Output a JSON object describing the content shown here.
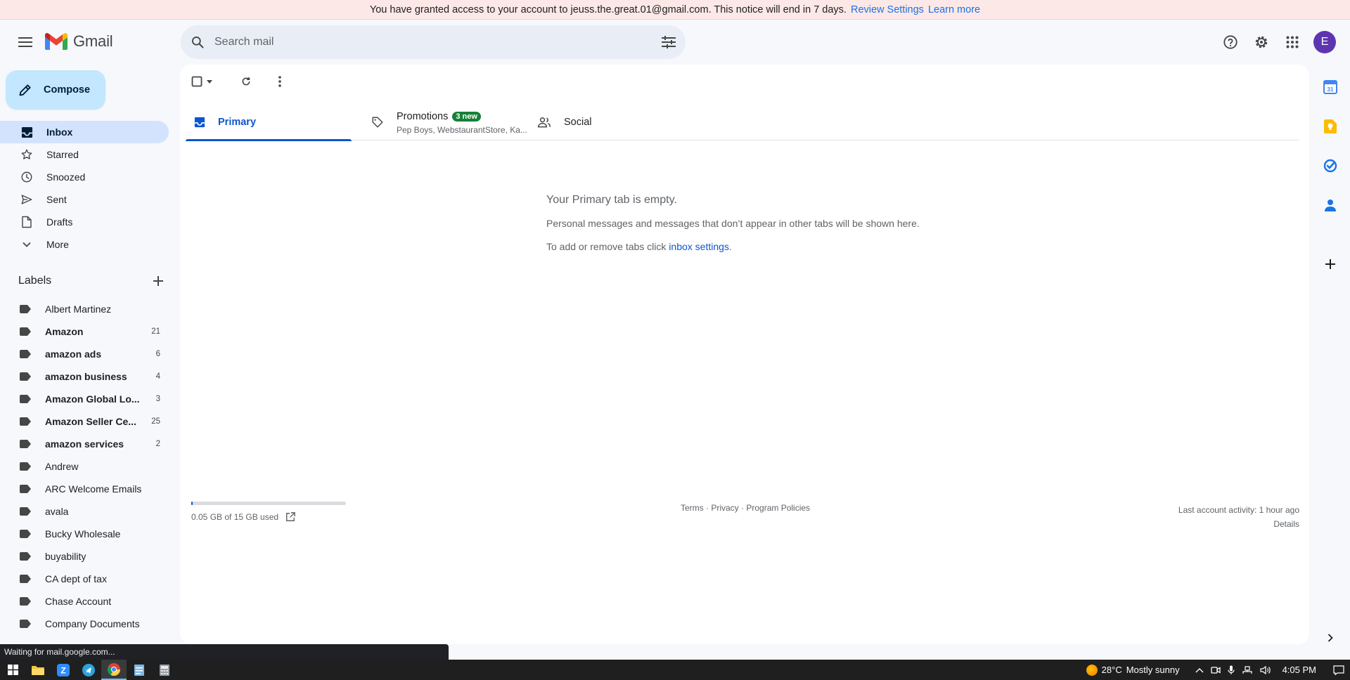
{
  "notice": {
    "text": "You have granted access to your account to jeuss.the.great.01@gmail.com. This notice will end in 7 days.",
    "review_link": "Review Settings",
    "learn_link": "Learn more"
  },
  "header": {
    "app_name": "Gmail",
    "search_placeholder": "Search mail",
    "avatar_letter": "E"
  },
  "compose": {
    "label": "Compose"
  },
  "nav": {
    "items": [
      {
        "label": "Inbox"
      },
      {
        "label": "Starred"
      },
      {
        "label": "Snoozed"
      },
      {
        "label": "Sent"
      },
      {
        "label": "Drafts"
      },
      {
        "label": "More"
      }
    ]
  },
  "labels": {
    "title": "Labels",
    "items": [
      {
        "name": "Albert Martinez",
        "count": ""
      },
      {
        "name": "Amazon",
        "count": "21"
      },
      {
        "name": "amazon ads",
        "count": "6"
      },
      {
        "name": "amazon business",
        "count": "4"
      },
      {
        "name": "Amazon Global Lo...",
        "count": "3"
      },
      {
        "name": "Amazon Seller Ce...",
        "count": "25"
      },
      {
        "name": "amazon services",
        "count": "2"
      },
      {
        "name": "Andrew",
        "count": ""
      },
      {
        "name": "ARC Welcome Emails",
        "count": ""
      },
      {
        "name": "avala",
        "count": ""
      },
      {
        "name": "Bucky Wholesale",
        "count": ""
      },
      {
        "name": "buyability",
        "count": ""
      },
      {
        "name": "CA dept of tax",
        "count": ""
      },
      {
        "name": "Chase Account",
        "count": ""
      },
      {
        "name": "Company Documents",
        "count": ""
      }
    ]
  },
  "tabs": {
    "primary": "Primary",
    "promotions": "Promotions",
    "promotions_badge": "3 new",
    "promotions_sub": "Pep Boys, WebstaurantStore, Ka...",
    "social": "Social"
  },
  "empty": {
    "title": "Your Primary tab is empty.",
    "line1": "Personal messages and messages that don’t appear in other tabs will be shown here.",
    "line2_prefix": "To add or remove tabs click",
    "line2_link": "inbox settings",
    "line2_suffix": "."
  },
  "footer": {
    "storage_text": "0.05 GB of 15 GB used",
    "storage_fraction": 0.0033,
    "terms": "Terms",
    "privacy": "Privacy",
    "policies": "Program Policies",
    "sep": "·",
    "last_activity": "Last account activity: 1 hour ago",
    "details": "Details"
  },
  "status_bar": {
    "text": "Waiting for mail.google.com..."
  },
  "taskbar": {
    "weather_temp": "28°C",
    "weather_desc": "Mostly sunny",
    "time": "4:05 PM"
  },
  "colors": {
    "accent": "#0b57d0",
    "compose_bg": "#c2e7ff",
    "active_nav": "#d3e3fd",
    "badge_green": "#188038",
    "avatar": "#5e35b1",
    "notice_bg": "#fce8e6"
  }
}
